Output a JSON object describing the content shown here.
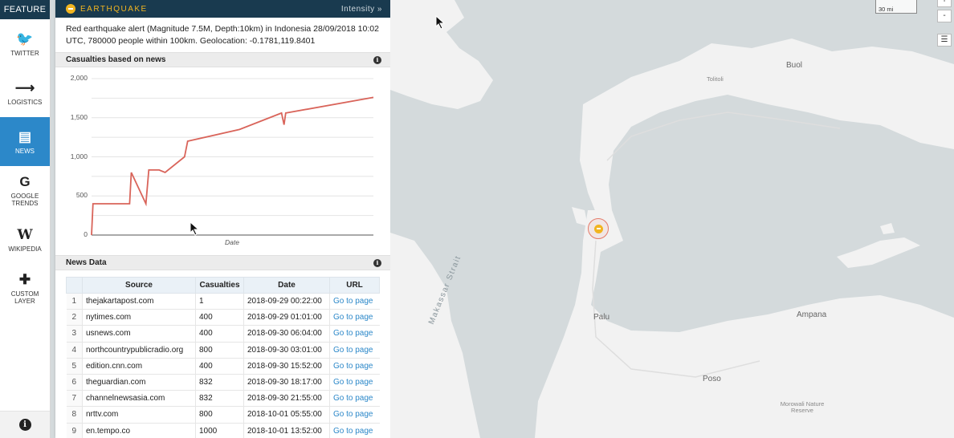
{
  "sidebar": {
    "header": "FEATURE",
    "items": [
      {
        "label": "TWITTER",
        "icon": "twitter-icon",
        "glyph": "🐦"
      },
      {
        "label": "LOGISTICS",
        "icon": "arrow-right-icon",
        "glyph": "⟶"
      },
      {
        "label": "NEWS",
        "icon": "newspaper-icon",
        "glyph": "▤"
      },
      {
        "label": "GOOGLE TRENDS",
        "icon": "google-icon",
        "glyph": "G"
      },
      {
        "label": "WIKIPEDIA",
        "icon": "wikipedia-icon",
        "glyph": "W"
      },
      {
        "label": "CUSTOM LAYER",
        "icon": "plus-icon",
        "glyph": "✚"
      }
    ],
    "bottom_icon": "i"
  },
  "panel": {
    "title": "EARTHQUAKE",
    "intensity_link": "Intensity »",
    "description": "Red earthquake alert (Magnitude 7.5M, Depth:10km) in Indonesia 28/09/2018 10:02 UTC, 780000 people within 100km. Geolocation: -0.1781,119.8401",
    "casualties_title": "Casualties based on news",
    "news_title": "News Data",
    "info_glyph": "i"
  },
  "chart_data": {
    "type": "line",
    "title": "",
    "xlabel": "Date",
    "ylabel": "",
    "ylim": [
      0,
      2000
    ],
    "yticks": [
      0,
      500,
      1000,
      1500,
      2000
    ],
    "ytick_labels": [
      "0",
      "500",
      "1,000",
      "1,500",
      "2,000"
    ],
    "grid": true,
    "color": "#d9645a",
    "series": [
      {
        "values": [
          0,
          400,
          400,
          400,
          800,
          400,
          832,
          832,
          800,
          1000,
          1200,
          1350,
          1560,
          1410,
          1560,
          1760
        ]
      }
    ],
    "x": [
      0,
      0.5,
      10,
      13.5,
      14.1,
      19.3,
      20.3,
      24,
      26.1,
      33,
      34.1,
      52.5,
      67.4,
      68.3,
      68.9,
      100
    ]
  },
  "table": {
    "columns": [
      "",
      "Source",
      "Casualties",
      "Date",
      "URL"
    ],
    "rows": [
      {
        "n": "1",
        "source": "thejakartapost.com",
        "casualties": "1",
        "date": "2018-09-29 00:22:00",
        "url": "Go to page"
      },
      {
        "n": "2",
        "source": "nytimes.com",
        "casualties": "400",
        "date": "2018-09-29 01:01:00",
        "url": "Go to page"
      },
      {
        "n": "3",
        "source": "usnews.com",
        "casualties": "400",
        "date": "2018-09-30 06:04:00",
        "url": "Go to page"
      },
      {
        "n": "4",
        "source": "northcountrypublicradio.org",
        "casualties": "800",
        "date": "2018-09-30 03:01:00",
        "url": "Go to page"
      },
      {
        "n": "5",
        "source": "edition.cnn.com",
        "casualties": "400",
        "date": "2018-09-30 15:52:00",
        "url": "Go to page"
      },
      {
        "n": "6",
        "source": "theguardian.com",
        "casualties": "832",
        "date": "2018-09-30 18:17:00",
        "url": "Go to page"
      },
      {
        "n": "7",
        "source": "channelnewsasia.com",
        "casualties": "832",
        "date": "2018-09-30 21:55:00",
        "url": "Go to page"
      },
      {
        "n": "8",
        "source": "nrttv.com",
        "casualties": "800",
        "date": "2018-10-01 05:55:00",
        "url": "Go to page"
      },
      {
        "n": "9",
        "source": "en.tempo.co",
        "casualties": "1000",
        "date": "2018-10-01 13:52:00",
        "url": "Go to page"
      }
    ]
  },
  "map": {
    "places": {
      "buol": "Buol",
      "palu": "Palu",
      "ampana": "Ampana",
      "poso": "Poso",
      "tolitoli": "Tolitoli",
      "morowali": "Morowali Nature Reserve"
    },
    "strait": "Makassar Strait",
    "scale": "30 mi",
    "zoom_in": "+",
    "zoom_out": "-",
    "layers_glyph": "☰",
    "colors": {
      "water": "#d4dadc",
      "land": "#f2f2f2",
      "marker": "#e57a68",
      "quake": "#f1b521"
    }
  }
}
